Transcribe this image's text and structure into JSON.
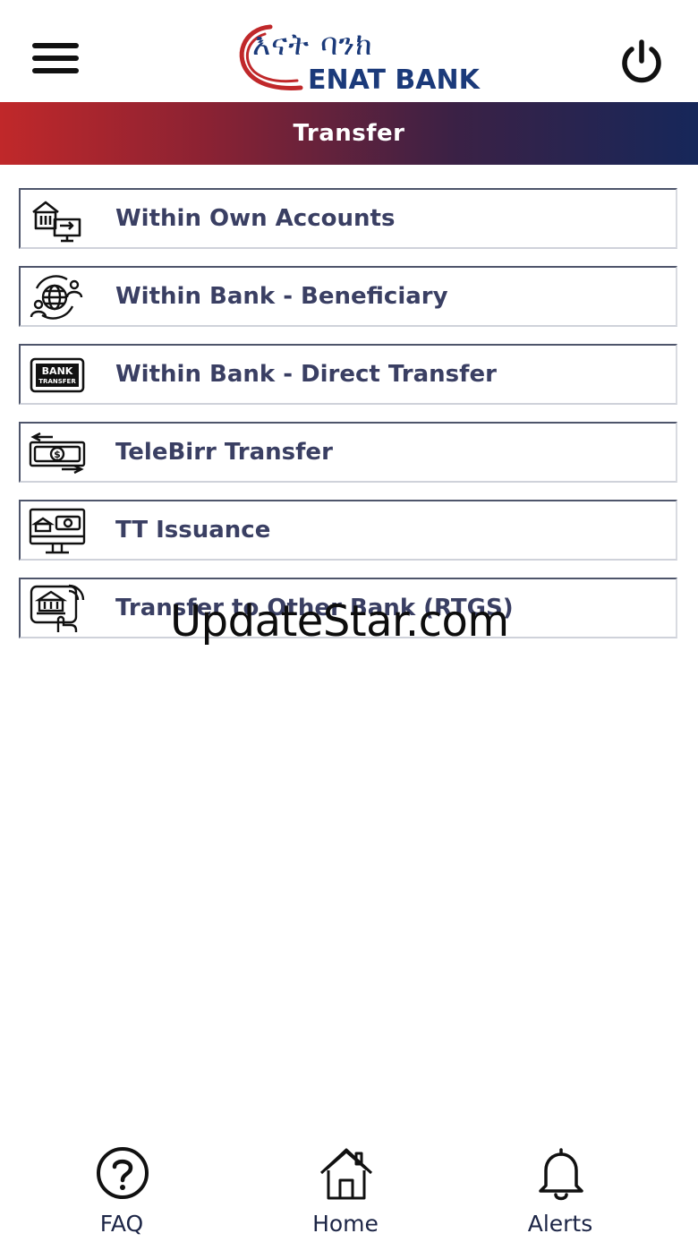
{
  "header": {
    "logo_amharic": "እናት ባንክ",
    "logo_english": "ENAT BANK",
    "menu_icon": "hamburger-menu-icon",
    "power_icon": "power-icon"
  },
  "page": {
    "title": "Transfer"
  },
  "menu_items": [
    {
      "label": "Within Own Accounts",
      "icon": "own-accounts-icon"
    },
    {
      "label": "Within Bank - Beneficiary",
      "icon": "beneficiary-globe-icon"
    },
    {
      "label": "Within Bank - Direct Transfer",
      "icon": "bank-transfer-card-icon"
    },
    {
      "label": "TeleBirr Transfer",
      "icon": "money-exchange-icon"
    },
    {
      "label": "TT Issuance",
      "icon": "monitor-bank-icon"
    },
    {
      "label": "Transfer to Other Bank (RTGS)",
      "icon": "bank-touch-icon"
    }
  ],
  "watermark": "UpdateStar.com",
  "bottom_nav": [
    {
      "label": "FAQ",
      "icon": "question-circle-icon"
    },
    {
      "label": "Home",
      "icon": "home-icon"
    },
    {
      "label": "Alerts",
      "icon": "bell-icon"
    }
  ],
  "colors": {
    "brand_blue": "#1b3a7a",
    "brand_red": "#c0282a",
    "label_color": "#3a3f63"
  }
}
